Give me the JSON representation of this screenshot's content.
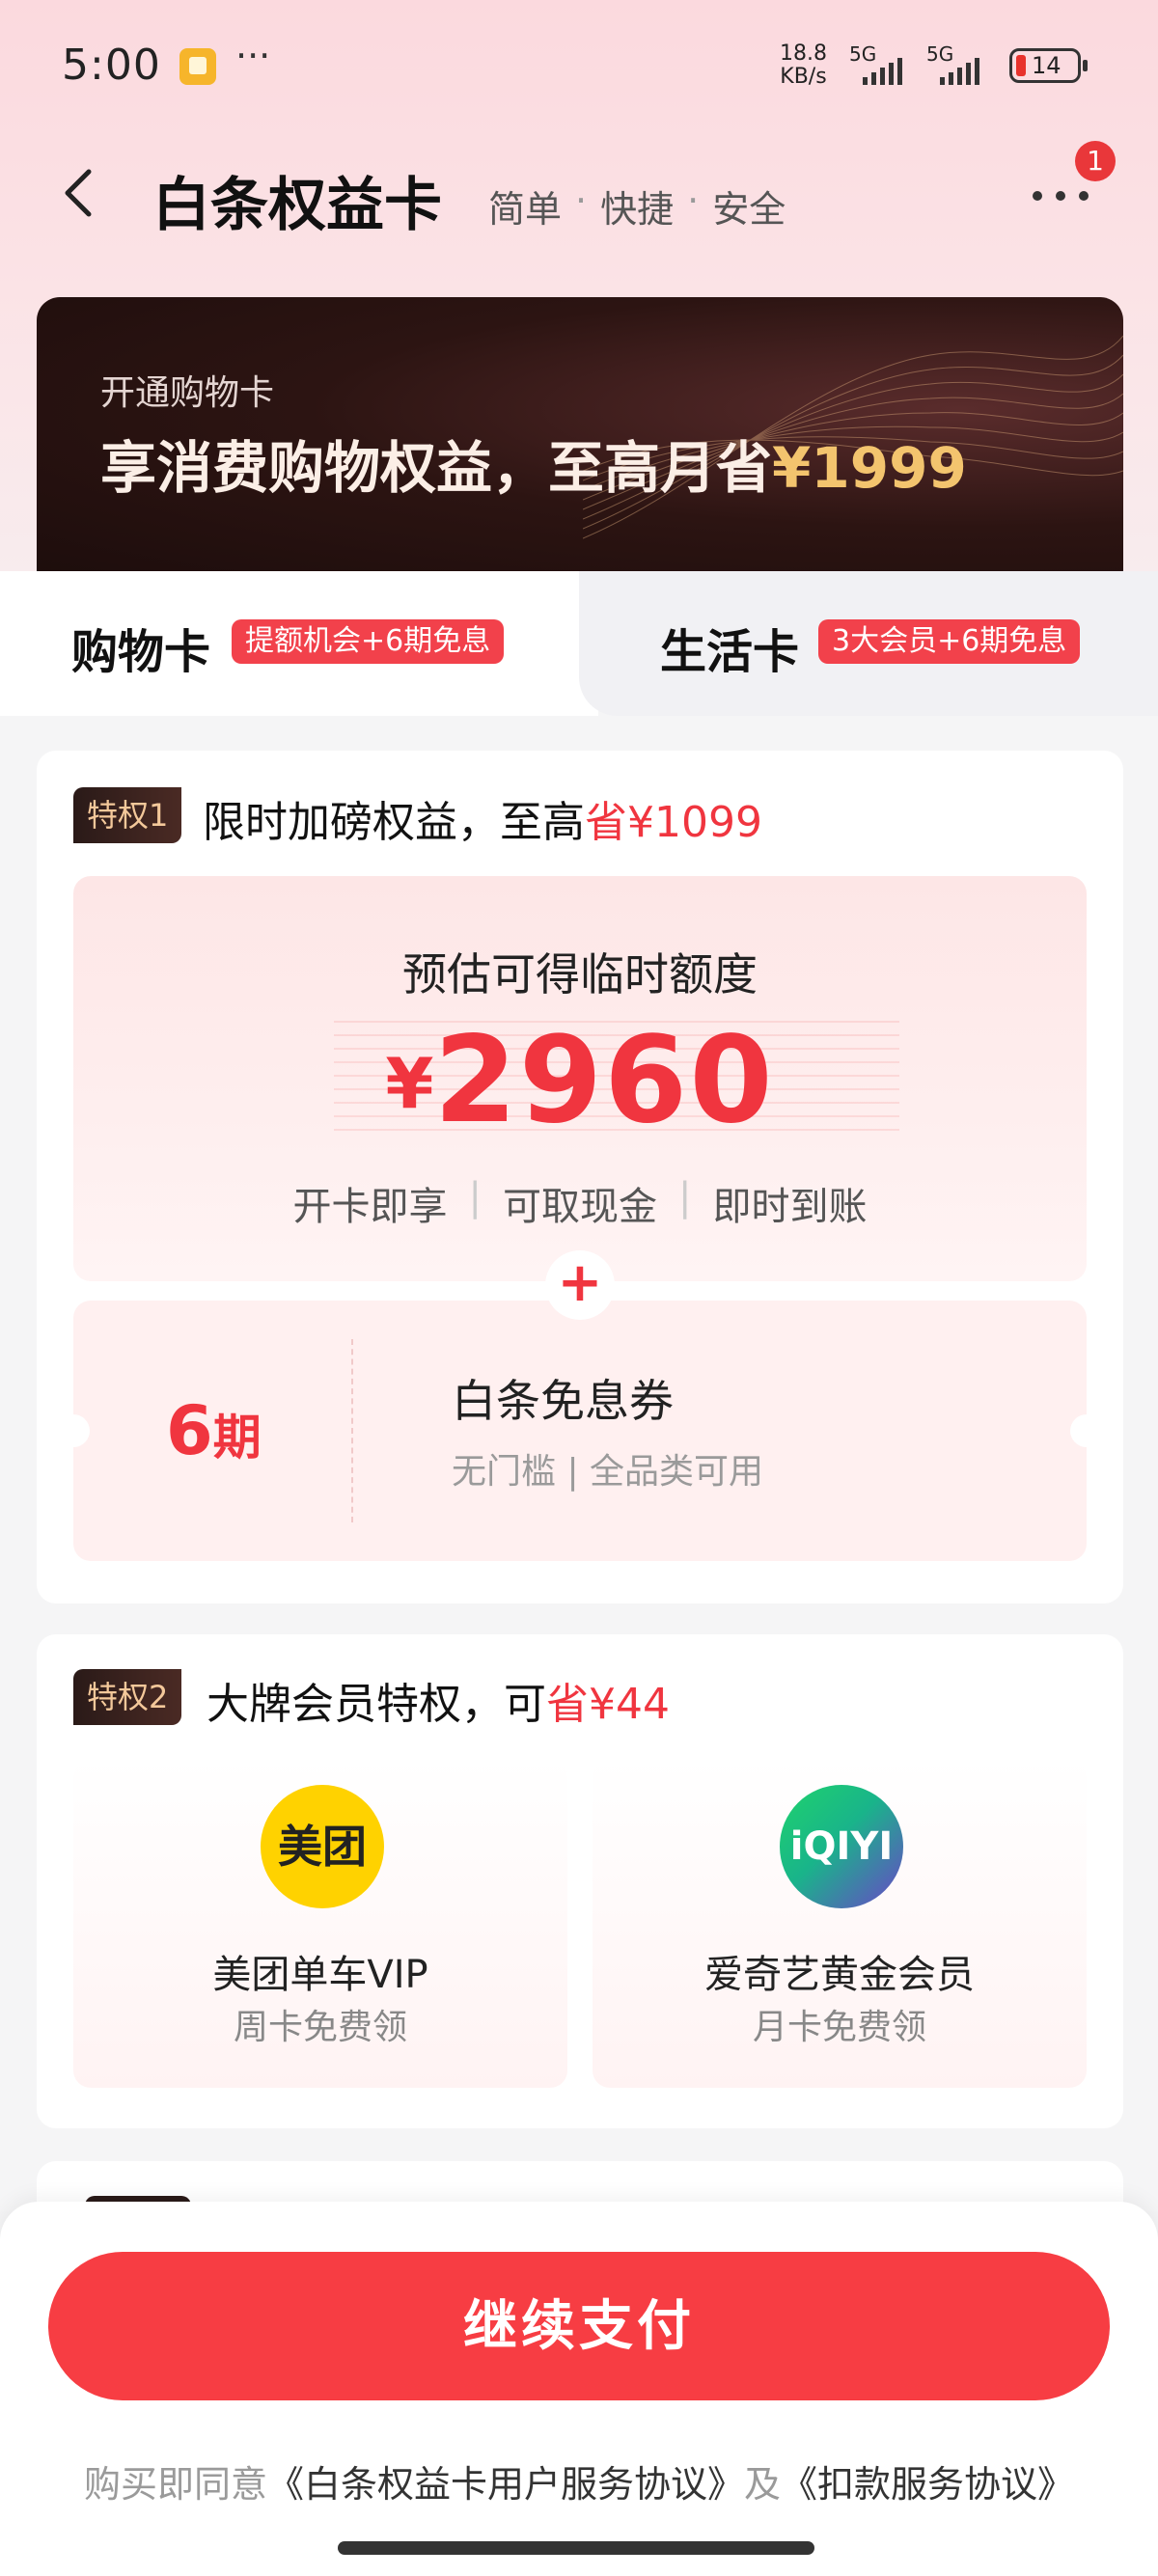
{
  "status_bar": {
    "time": "5:00",
    "speed_value": "18.8",
    "speed_unit": "KB/s",
    "signal1": "5G",
    "signal2": "5G",
    "battery": "14"
  },
  "header": {
    "title": "白条权益卡",
    "tags": [
      "简单",
      "快捷",
      "安全"
    ],
    "more_badge": "1"
  },
  "banner": {
    "subtitle": "开通购物卡",
    "headline": "享消费购物权益，至高月省",
    "headline_amount": "¥1999"
  },
  "tabs": [
    {
      "label": "购物卡",
      "tag": "提额机会+6期免息",
      "selected": true
    },
    {
      "label": "生活卡",
      "tag": "3大会员+6期免息",
      "selected": false
    }
  ],
  "privilege1": {
    "badge": "特权1",
    "title": "限时加磅权益，至高",
    "title_red": "省¥1099",
    "quota_title": "预估可得临时额度",
    "quota_currency": "¥",
    "quota_value": "2960",
    "features": [
      "开卡即享",
      "可取现金",
      "即时到账"
    ],
    "plus": "+",
    "coupon_num": "6",
    "coupon_unit": "期",
    "coupon_name": "白条免息券",
    "coupon_desc": "无门槛 | 全品类可用"
  },
  "privilege2": {
    "badge": "特权2",
    "title": "大牌会员特权，可",
    "title_red": "省¥44",
    "members": [
      {
        "logo": "美团",
        "name": "美团单车VIP",
        "sub": "周卡免费领"
      },
      {
        "logo": "iQIYI",
        "name": "爱奇艺黄金会员",
        "sub": "月卡免费领"
      }
    ]
  },
  "footer": {
    "pay_button": "继续支付",
    "agree_prefix": "购买即同意",
    "agree_link1": "《白条权益卡用户服务协议》",
    "agree_mid": "及",
    "agree_link2": "《扣款服务协议》"
  },
  "colors": {
    "accent": "#f73d43",
    "red_text": "#f0353f",
    "gold": "#f3c46e"
  }
}
